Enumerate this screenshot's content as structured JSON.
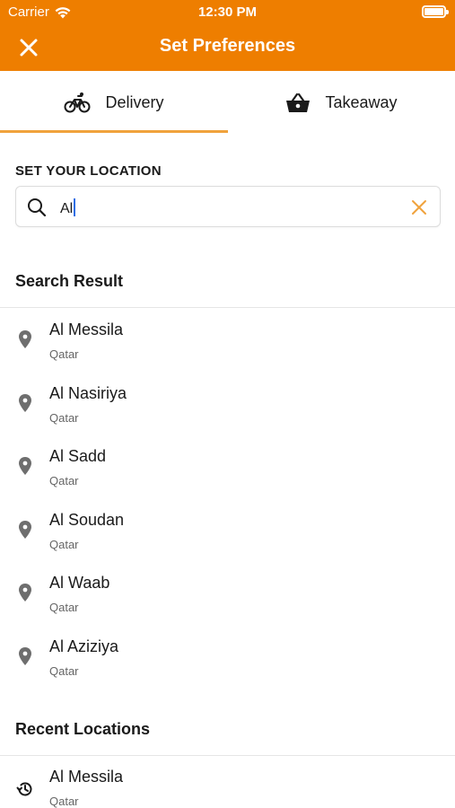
{
  "status_bar": {
    "carrier": "Carrier",
    "time": "12:30 PM"
  },
  "header": {
    "title": "Set Preferences",
    "close_icon": "close-icon"
  },
  "tabs": [
    {
      "label": "Delivery",
      "icon": "bicycle-icon",
      "active": true
    },
    {
      "label": "Takeaway",
      "icon": "basket-icon",
      "active": false
    }
  ],
  "location": {
    "section_label": "SET YOUR LOCATION",
    "search_value": "Al",
    "search_icon": "search-icon",
    "clear_icon": "clear-icon"
  },
  "search_results": {
    "heading": "Search Result",
    "items": [
      {
        "name": "Al Messila",
        "country": "Qatar"
      },
      {
        "name": "Al Nasiriya",
        "country": "Qatar"
      },
      {
        "name": "Al Sadd",
        "country": "Qatar"
      },
      {
        "name": "Al Soudan",
        "country": "Qatar"
      },
      {
        "name": "Al Waab",
        "country": "Qatar"
      },
      {
        "name": "Al Aziziya",
        "country": "Qatar"
      }
    ]
  },
  "recent_locations": {
    "heading": "Recent Locations",
    "items": [
      {
        "name": "Al Messila",
        "country": "Qatar"
      }
    ]
  },
  "colors": {
    "accent": "#ee7e00",
    "tab_indicator": "#f0a23c",
    "clear_icon": "#f0a23c"
  }
}
